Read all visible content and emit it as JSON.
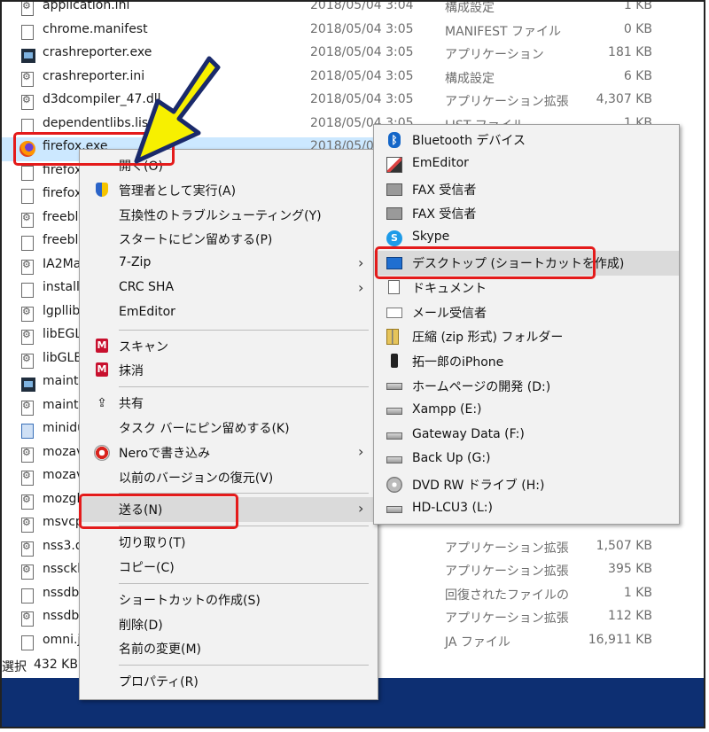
{
  "files": [
    {
      "name": "application.ini",
      "date": "2018/05/04 3:04",
      "type": "構成設定",
      "size": "1 KB",
      "icon": "gear"
    },
    {
      "name": "chrome.manifest",
      "date": "2018/05/04 3:05",
      "type": "MANIFEST ファイル",
      "size": "0 KB",
      "icon": "file"
    },
    {
      "name": "crashreporter.exe",
      "date": "2018/05/04 3:05",
      "type": "アプリケーション",
      "size": "181 KB",
      "icon": "app"
    },
    {
      "name": "crashreporter.ini",
      "date": "2018/05/04 3:05",
      "type": "構成設定",
      "size": "6 KB",
      "icon": "gear"
    },
    {
      "name": "d3dcompiler_47.dll",
      "date": "2018/05/04 3:05",
      "type": "アプリケーション拡張",
      "size": "4,307 KB",
      "icon": "dll"
    },
    {
      "name": "dependentlibs.list",
      "date": "2018/05/04 3:05",
      "type": "LIST ファイル",
      "size": "1 KB",
      "icon": "file"
    },
    {
      "name": "firefox.exe",
      "date": "2018/05/04",
      "type": "",
      "size": "",
      "icon": "ff",
      "selected": true
    },
    {
      "name": "firefox",
      "date": "",
      "type": "",
      "size": "",
      "icon": "file"
    },
    {
      "name": "firefox",
      "date": "",
      "type": "",
      "size": "",
      "icon": "file"
    },
    {
      "name": "freebl3",
      "date": "",
      "type": "",
      "size": "",
      "icon": "dll"
    },
    {
      "name": "freebl3",
      "date": "",
      "type": "",
      "size": "",
      "icon": "file"
    },
    {
      "name": "IA2Ma",
      "date": "",
      "type": "",
      "size": "",
      "icon": "dll"
    },
    {
      "name": "install.",
      "date": "",
      "type": "",
      "size": "",
      "icon": "file"
    },
    {
      "name": "lgpllib",
      "date": "",
      "type": "",
      "size": "",
      "icon": "dll"
    },
    {
      "name": "libEGL",
      "date": "",
      "type": "",
      "size": "",
      "icon": "dll"
    },
    {
      "name": "libGLE",
      "date": "",
      "type": "",
      "size": "",
      "icon": "dll"
    },
    {
      "name": "mainte",
      "date": "",
      "type": "",
      "size": "",
      "icon": "app"
    },
    {
      "name": "mainte",
      "date": "",
      "type": "",
      "size": "",
      "icon": "gear"
    },
    {
      "name": "minidu",
      "date": "",
      "type": "",
      "size": "",
      "icon": "blue"
    },
    {
      "name": "mozav",
      "date": "",
      "type": "",
      "size": "",
      "icon": "dll"
    },
    {
      "name": "mozav",
      "date": "",
      "type": "",
      "size": "",
      "icon": "dll"
    },
    {
      "name": "mozgl",
      "date": "",
      "type": "",
      "size": "",
      "icon": "dll"
    },
    {
      "name": "msvcp",
      "date": "",
      "type": "",
      "size": "",
      "icon": "dll"
    },
    {
      "name": "nss3.d",
      "date": "3:05",
      "type": "アプリケーション拡張",
      "size": "1,507 KB",
      "icon": "dll"
    },
    {
      "name": "nssckb",
      "date": "3:05",
      "type": "アプリケーション拡張",
      "size": "395 KB",
      "icon": "dll"
    },
    {
      "name": "nssdbr",
      "date": "3:05",
      "type": "回復されたファイルの",
      "size": "1 KB",
      "icon": "file"
    },
    {
      "name": "nssdbr",
      "date": "3:05",
      "type": "アプリケーション拡張",
      "size": "112 KB",
      "icon": "dll"
    },
    {
      "name": "omni.j",
      "date": "3:05",
      "type": "JA ファイル",
      "size": "16,911 KB",
      "icon": "file"
    }
  ],
  "status": {
    "selected_label": "選択",
    "selected_size": "432 KB"
  },
  "context_menu": [
    {
      "label": "開く(O)",
      "icon": "",
      "type": "item"
    },
    {
      "label": "管理者として実行(A)",
      "icon": "shield",
      "type": "item"
    },
    {
      "label": "互換性のトラブルシューティング(Y)",
      "icon": "",
      "type": "item"
    },
    {
      "label": "スタートにピン留めする(P)",
      "icon": "",
      "type": "item"
    },
    {
      "label": "7-Zip",
      "icon": "",
      "type": "submenu"
    },
    {
      "label": "CRC SHA",
      "icon": "",
      "type": "submenu"
    },
    {
      "label": "EmEditor",
      "icon": "",
      "type": "item"
    },
    {
      "type": "sep"
    },
    {
      "label": "スキャン",
      "icon": "mcafee",
      "type": "item"
    },
    {
      "label": "抹消",
      "icon": "mcafee",
      "type": "item"
    },
    {
      "type": "sep"
    },
    {
      "label": "共有",
      "icon": "share",
      "type": "item"
    },
    {
      "label": "タスク バーにピン留めする(K)",
      "icon": "",
      "type": "item"
    },
    {
      "label": "Neroで書き込み",
      "icon": "nero",
      "type": "submenu"
    },
    {
      "label": "以前のバージョンの復元(V)",
      "icon": "",
      "type": "item"
    },
    {
      "type": "sep"
    },
    {
      "label": "送る(N)",
      "icon": "",
      "type": "submenu",
      "hover": true
    },
    {
      "type": "sep"
    },
    {
      "label": "切り取り(T)",
      "icon": "",
      "type": "item"
    },
    {
      "label": "コピー(C)",
      "icon": "",
      "type": "item"
    },
    {
      "type": "sep"
    },
    {
      "label": "ショートカットの作成(S)",
      "icon": "",
      "type": "item"
    },
    {
      "label": "削除(D)",
      "icon": "",
      "type": "item"
    },
    {
      "label": "名前の変更(M)",
      "icon": "",
      "type": "item"
    },
    {
      "type": "sep"
    },
    {
      "label": "プロパティ(R)",
      "icon": "",
      "type": "item"
    }
  ],
  "send_to_menu": [
    {
      "label": "Bluetooth デバイス",
      "icon": "bluetooth"
    },
    {
      "label": "EmEditor",
      "icon": "emeditor"
    },
    {
      "label": "FAX 受信者",
      "icon": "fax"
    },
    {
      "label": "FAX 受信者",
      "icon": "fax"
    },
    {
      "label": "Skype",
      "icon": "skype"
    },
    {
      "label": "デスクトップ (ショートカットを作成)",
      "icon": "desktop",
      "hover": true
    },
    {
      "label": "ドキュメント",
      "icon": "document"
    },
    {
      "label": "メール受信者",
      "icon": "mail"
    },
    {
      "label": "圧縮 (zip 形式) フォルダー",
      "icon": "zip"
    },
    {
      "label": "拓一郎のiPhone",
      "icon": "phone"
    },
    {
      "label": "ホームページの開発 (D:)",
      "icon": "drive"
    },
    {
      "label": "Xampp (E:)",
      "icon": "drive"
    },
    {
      "label": "Gateway Data (F:)",
      "icon": "drive"
    },
    {
      "label": "Back Up (G:)",
      "icon": "drive"
    },
    {
      "label": "DVD RW ドライブ (H:)",
      "icon": "dvd"
    },
    {
      "label": "HD-LCU3 (L:)",
      "icon": "drive"
    }
  ],
  "colors": {
    "highlight": "#e41b1b",
    "arrow": "#f7f000",
    "selection": "#cce8ff",
    "taskbar": "#0d2f72"
  }
}
